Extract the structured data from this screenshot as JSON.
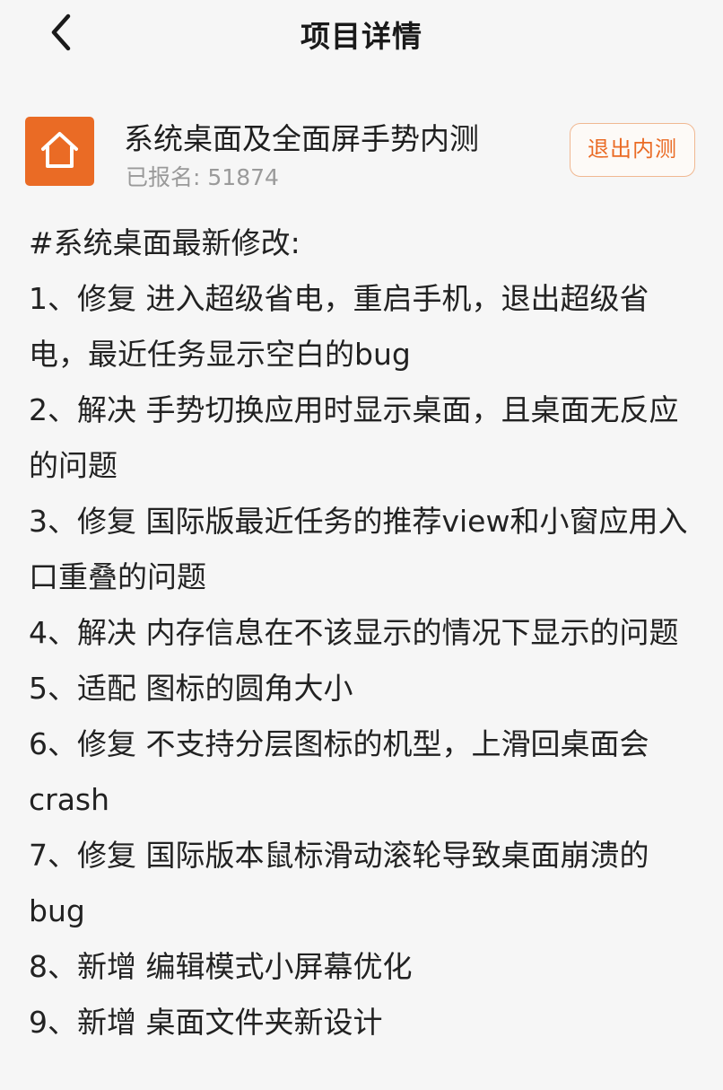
{
  "header": {
    "title": "项目详情",
    "back_icon": "chevron-left-icon"
  },
  "project": {
    "icon": "home-icon",
    "icon_color": "#ea6b25",
    "title": "系统桌面及全面屏手势内测",
    "signup_label": "已报名:",
    "signup_count": "51874",
    "exit_label": "退出内测"
  },
  "colors": {
    "accent": "#ea6b25",
    "button_border": "#f0b892",
    "muted_text": "#9a9a9a"
  },
  "changelog": {
    "heading": "#系统桌面最新修改:",
    "items": [
      "1、修复  进入超级省电，重启手机，退出超级省电，最近任务显示空白的bug",
      "2、解决  手势切换应用时显示桌面，且桌面无反应  的问题",
      "3、修复  国际版最近任务的推荐view和小窗应用入口重叠的问题",
      "4、解决  内存信息在不该显示的情况下显示的问题",
      "5、适配  图标的圆角大小",
      "6、修复  不支持分层图标的机型，上滑回桌面会crash",
      "7、修复  国际版本鼠标滑动滚轮导致桌面崩溃的bug",
      "8、新增  编辑模式小屏幕优化",
      "9、新增  桌面文件夹新设计"
    ]
  }
}
